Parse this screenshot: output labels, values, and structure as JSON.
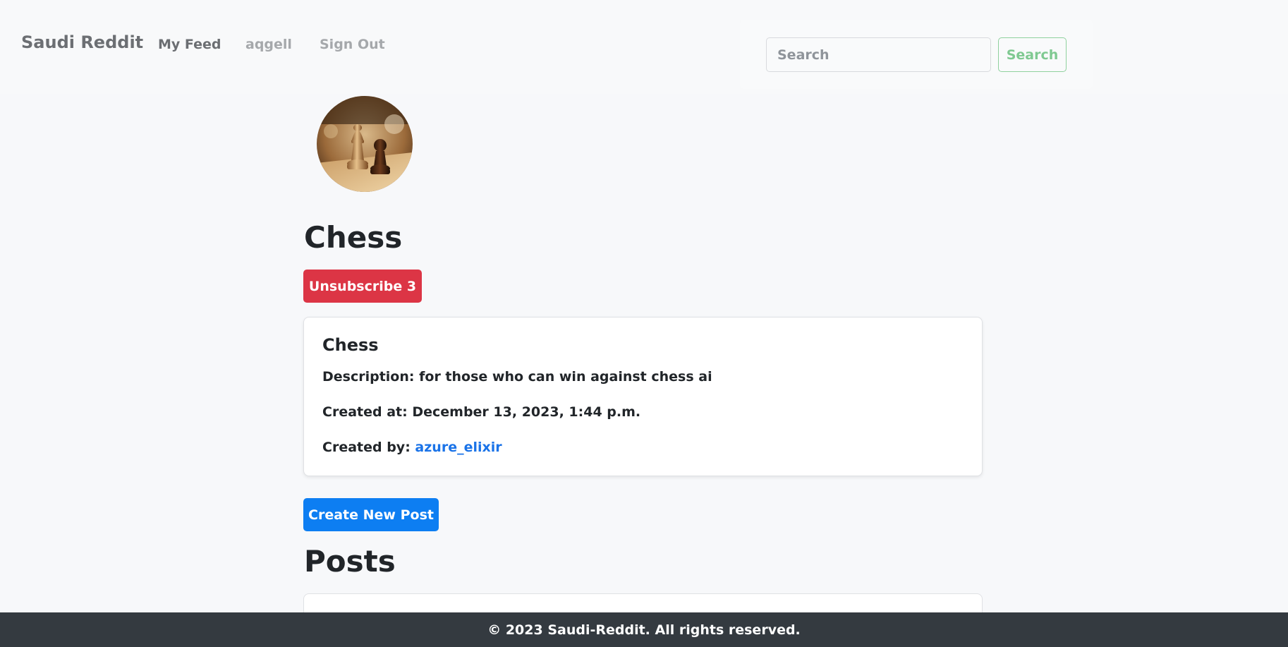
{
  "navbar": {
    "brand": "Saudi Reddit",
    "links": [
      "My Feed",
      "aqgell",
      "Sign Out"
    ],
    "search_placeholder": "Search",
    "search_button": "Search"
  },
  "community": {
    "title": "Chess",
    "unsubscribe_label": "Unsubscribe 3",
    "card": {
      "title": "Chess",
      "description_label": "Description:",
      "description": "for those who can win against chess ai",
      "created_at_label": "Created at:",
      "created_at": "December 13, 2023, 1:44 p.m.",
      "created_by_label": "Created by:",
      "created_by": "azure_elixir"
    }
  },
  "actions": {
    "create_post": "Create New Post"
  },
  "posts": {
    "heading": "Posts"
  },
  "footer": {
    "text": "© 2023 Saudi-Reddit. All rights reserved."
  },
  "colors": {
    "danger": "#dc3545",
    "primary": "#0d7ef2",
    "success_outline": "#8fd19e",
    "footer_bg": "#343a40",
    "link": "#1a73e8"
  },
  "icons": {
    "avatar": "chess-pieces-image"
  }
}
